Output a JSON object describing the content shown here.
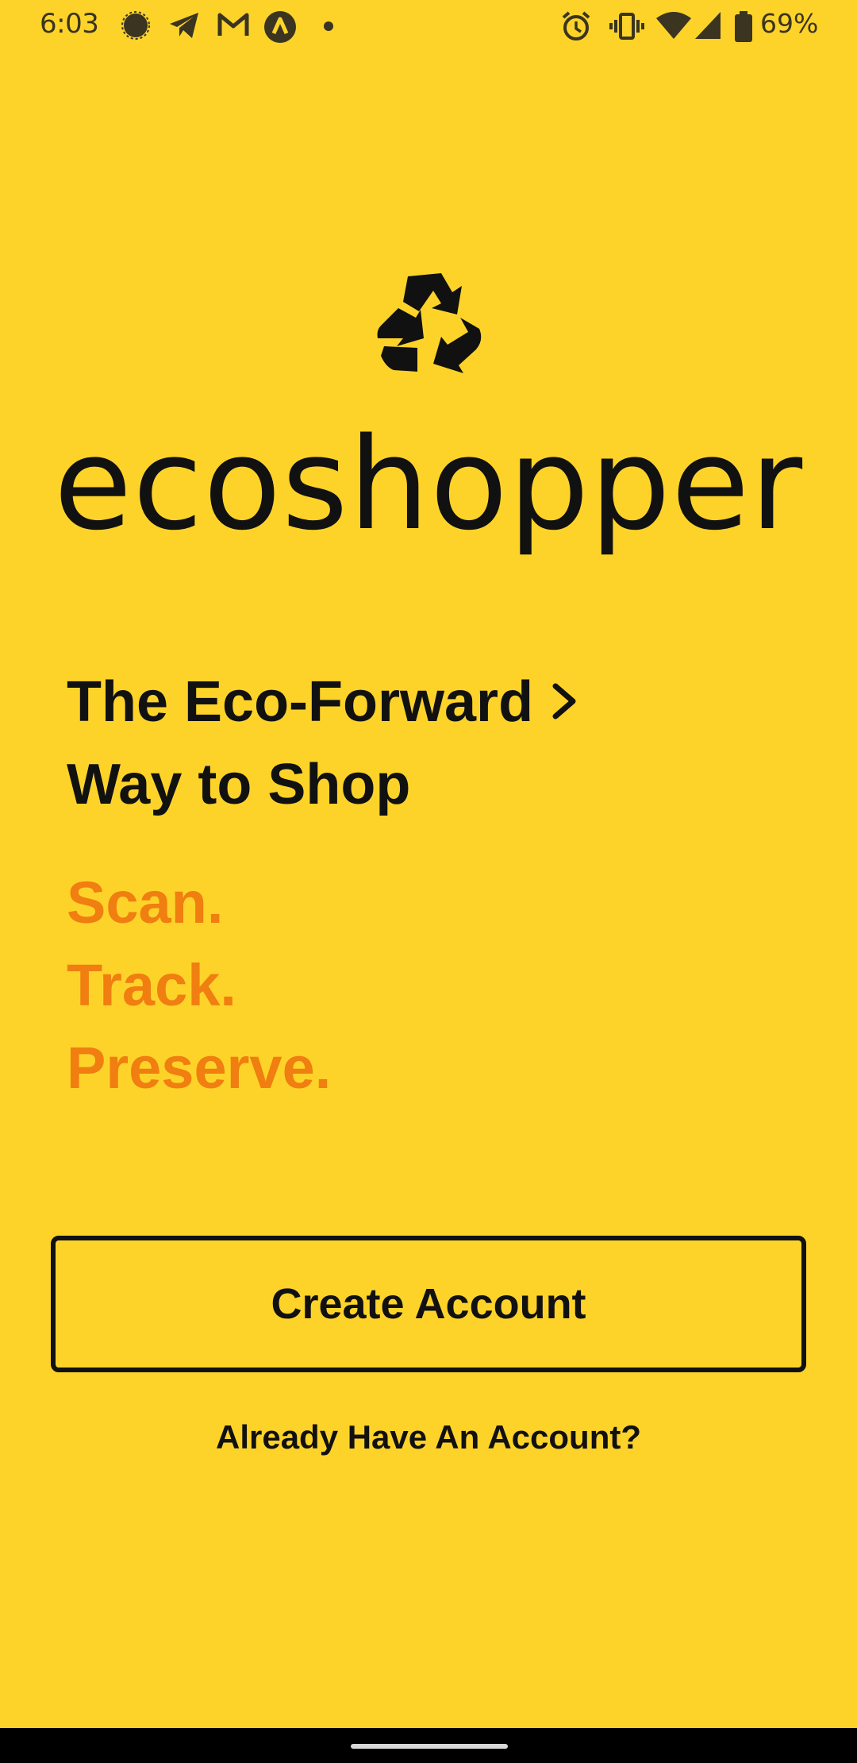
{
  "status_bar": {
    "time": "6:03",
    "battery_percent": "69%",
    "left_icons": [
      "signal-messenger-icon",
      "telegram-icon",
      "gmail-icon",
      "arc-app-icon",
      "notification-dot-icon"
    ],
    "right_icons": [
      "alarm-icon",
      "vibrate-icon",
      "wifi-icon",
      "cell-signal-icon",
      "battery-icon"
    ]
  },
  "logo": {
    "icon": "recycle-icon",
    "brand_name": "ecoshopper"
  },
  "tagline": {
    "line1": "The Eco-Forward",
    "line2": "Way to Shop",
    "icon": "chevron-right-icon"
  },
  "steps": [
    "Scan.",
    "Track.",
    "Preserve."
  ],
  "actions": {
    "create_account": "Create Account",
    "login": "Already Have An Account?"
  },
  "colors": {
    "background": "#FDD32A",
    "accent": "#F07E10",
    "text": "#111111"
  }
}
